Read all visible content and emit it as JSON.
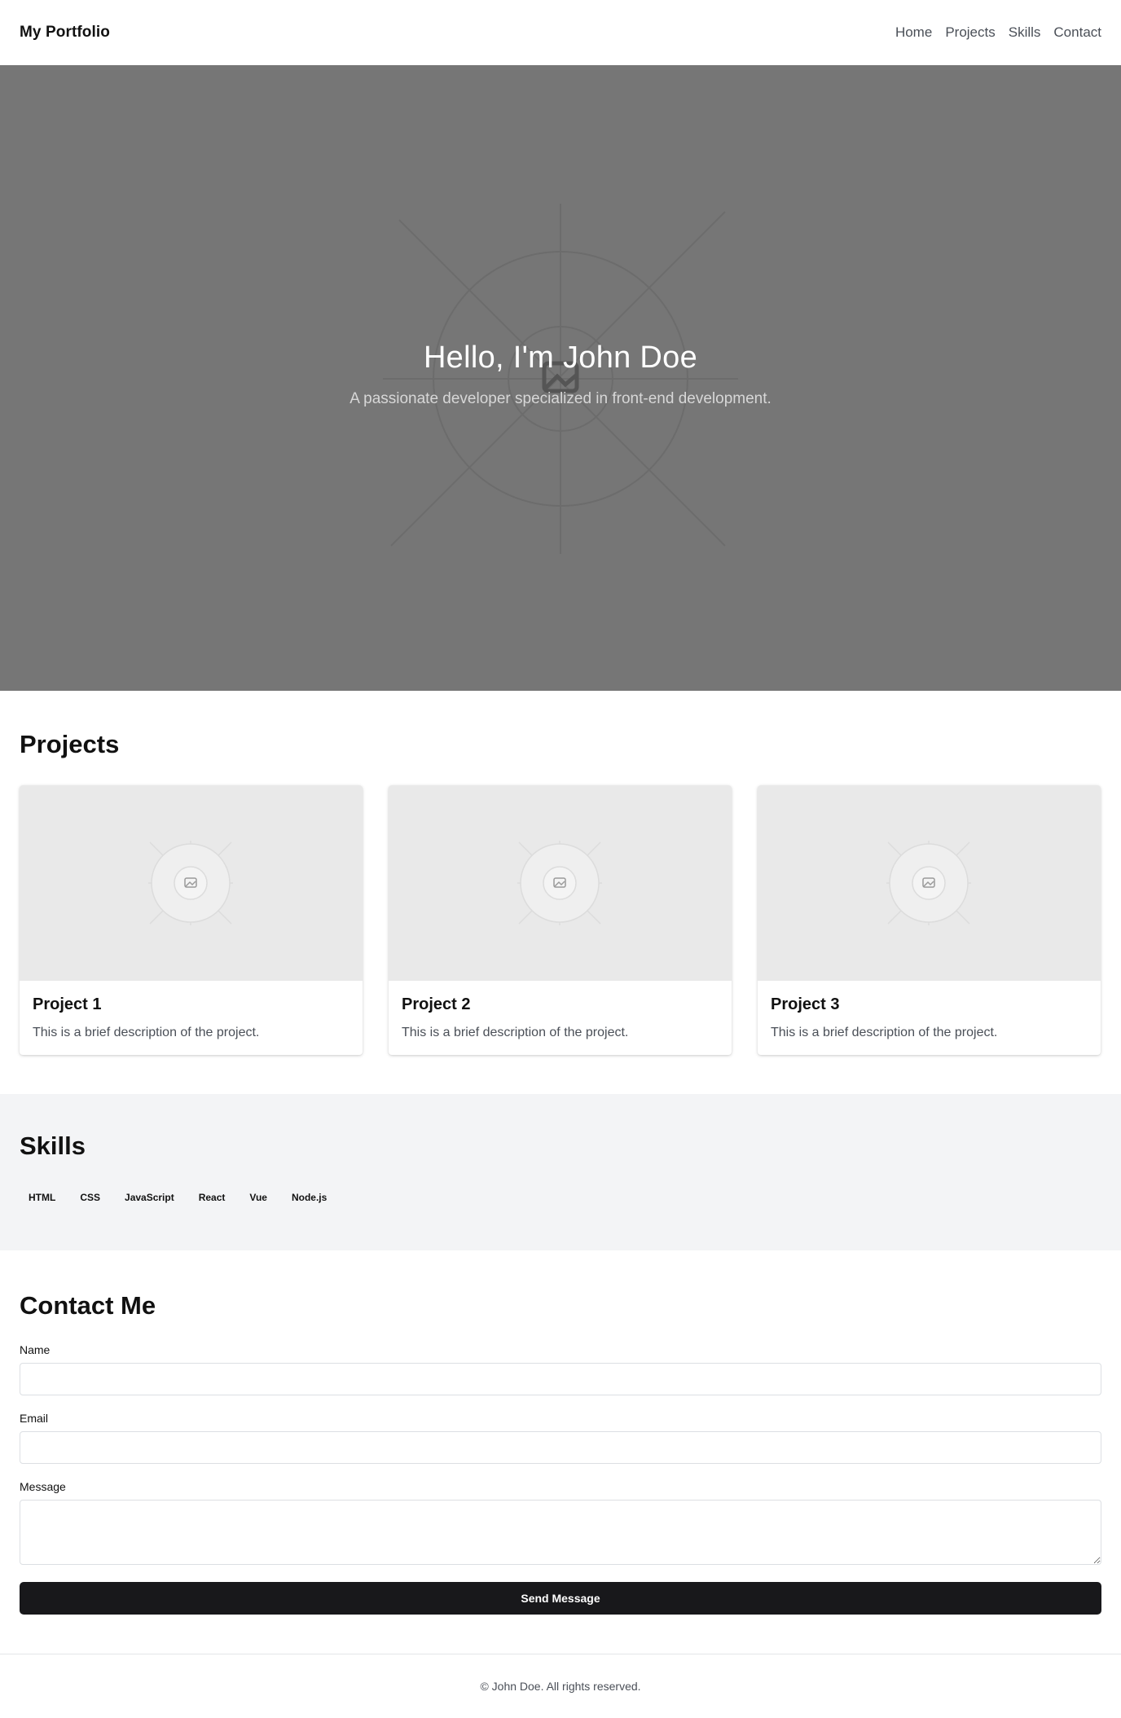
{
  "header": {
    "brand": "My Portfolio",
    "nav": [
      "Home",
      "Projects",
      "Skills",
      "Contact"
    ]
  },
  "hero": {
    "title": "Hello, I'm John Doe",
    "subtitle": "A passionate developer specialized in front-end development.",
    "image_icon": "image-placeholder-icon"
  },
  "projects": {
    "title": "Projects",
    "items": [
      {
        "title": "Project 1",
        "description": "This is a brief description of the project."
      },
      {
        "title": "Project 2",
        "description": "This is a brief description of the project."
      },
      {
        "title": "Project 3",
        "description": "This is a brief description of the project."
      }
    ]
  },
  "skills": {
    "title": "Skills",
    "items": [
      "HTML",
      "CSS",
      "JavaScript",
      "React",
      "Vue",
      "Node.js"
    ]
  },
  "contact": {
    "title": "Contact Me",
    "name_label": "Name",
    "email_label": "Email",
    "message_label": "Message",
    "submit_label": "Send Message"
  },
  "footer": {
    "text": "© John Doe. All rights reserved."
  },
  "colors": {
    "hero_bg": "#767676",
    "card_image_bg": "#e9e9e9",
    "skills_bg": "#f3f4f6",
    "button_bg": "#18181b"
  }
}
